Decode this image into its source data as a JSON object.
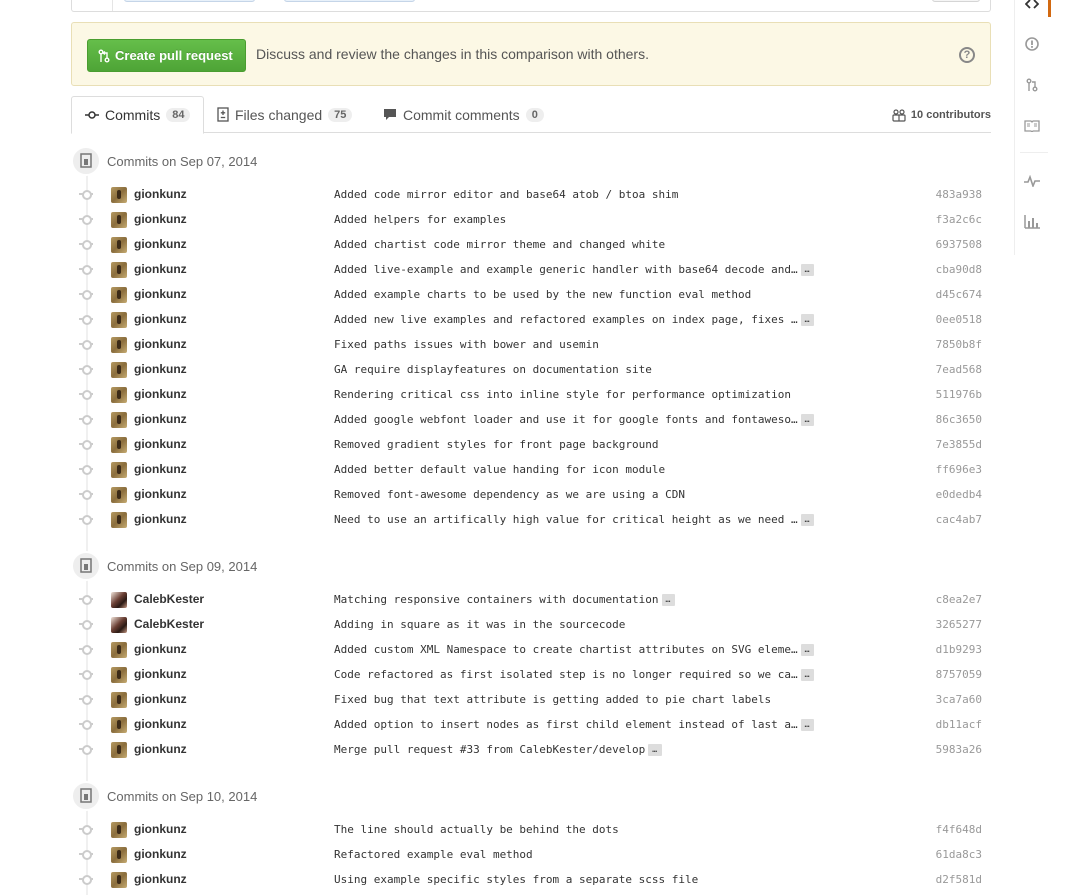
{
  "banner": {
    "button_label": "Create pull request",
    "text": "Discuss and review the changes in this comparison with others."
  },
  "tabs": [
    {
      "label": "Commits",
      "count": "84"
    },
    {
      "label": "Files changed",
      "count": "75"
    },
    {
      "label": "Commit comments",
      "count": "0"
    }
  ],
  "contributors": "10 contributors",
  "groups": [
    {
      "title": "Commits on Sep 07, 2014",
      "commits": [
        {
          "author": "gionkunz",
          "message": "Added code mirror editor and base64 atob / btoa shim",
          "sha": "483a938",
          "truncated": false
        },
        {
          "author": "gionkunz",
          "message": "Added helpers for examples",
          "sha": "f3a2c6c",
          "truncated": false
        },
        {
          "author": "gionkunz",
          "message": "Added chartist code mirror theme and changed white",
          "sha": "6937508",
          "truncated": false
        },
        {
          "author": "gionkunz",
          "message": "Added live-example and example generic handler with base64 decode and…",
          "sha": "cba90d8",
          "truncated": true
        },
        {
          "author": "gionkunz",
          "message": "Added example charts to be used by the new function eval method",
          "sha": "d45c674",
          "truncated": false
        },
        {
          "author": "gionkunz",
          "message": "Added new live examples and refactored examples on index page, fixes …",
          "sha": "0ee0518",
          "truncated": true
        },
        {
          "author": "gionkunz",
          "message": "Fixed paths issues with bower and usemin",
          "sha": "7850b8f",
          "truncated": false
        },
        {
          "author": "gionkunz",
          "message": "GA require displayfeatures on documentation site",
          "sha": "7ead568",
          "truncated": false
        },
        {
          "author": "gionkunz",
          "message": "Rendering critical css into inline style for performance optimization",
          "sha": "511976b",
          "truncated": false
        },
        {
          "author": "gionkunz",
          "message": "Added google webfont loader and use it for google fonts and fontaweso…",
          "sha": "86c3650",
          "truncated": true
        },
        {
          "author": "gionkunz",
          "message": "Removed gradient styles for front page background",
          "sha": "7e3855d",
          "truncated": false
        },
        {
          "author": "gionkunz",
          "message": "Added better default value handing for icon module",
          "sha": "ff696e3",
          "truncated": false
        },
        {
          "author": "gionkunz",
          "message": "Removed font-awesome dependency as we are using a CDN",
          "sha": "e0dedb4",
          "truncated": false
        },
        {
          "author": "gionkunz",
          "message": "Need to use an artifically high value for critical height as we need …",
          "sha": "cac4ab7",
          "truncated": true
        }
      ]
    },
    {
      "title": "Commits on Sep 09, 2014",
      "commits": [
        {
          "author": "CalebKester",
          "message": "Matching responsive containers with documentation",
          "sha": "c8ea2e7",
          "truncated": true
        },
        {
          "author": "CalebKester",
          "message": "Adding in square as it was in the sourcecode",
          "sha": "3265277",
          "truncated": false
        },
        {
          "author": "gionkunz",
          "message": "Added custom XML Namespace to create chartist attributes on SVG eleme…",
          "sha": "d1b9293",
          "truncated": true
        },
        {
          "author": "gionkunz",
          "message": "Code refactored as first isolated step is no longer required so we ca…",
          "sha": "8757059",
          "truncated": true
        },
        {
          "author": "gionkunz",
          "message": "Fixed bug that text attribute is getting added to pie chart labels",
          "sha": "3ca7a60",
          "truncated": false
        },
        {
          "author": "gionkunz",
          "message": "Added option to insert nodes as first child element instead of last a…",
          "sha": "db11acf",
          "truncated": true
        },
        {
          "author": "gionkunz",
          "message": "Merge pull request #33 from CalebKester/develop",
          "sha": "5983a26",
          "truncated": true
        }
      ]
    },
    {
      "title": "Commits on Sep 10, 2014",
      "commits": [
        {
          "author": "gionkunz",
          "message": "The line should actually be behind the dots",
          "sha": "f4f648d",
          "truncated": false
        },
        {
          "author": "gionkunz",
          "message": "Refactored example eval method",
          "sha": "61da8c3",
          "truncated": false
        },
        {
          "author": "gionkunz",
          "message": "Using example specific styles from a separate scss file",
          "sha": "d2f581d",
          "truncated": false
        }
      ]
    }
  ],
  "sidebar": {
    "icons": [
      "code-icon",
      "issues-icon",
      "pull-request-icon",
      "wiki-icon",
      "pulse-icon",
      "graphs-icon"
    ]
  },
  "colors": {
    "primary_button": "#55a532",
    "banner_bg": "#fcf8e5",
    "accent": "#d26911"
  }
}
